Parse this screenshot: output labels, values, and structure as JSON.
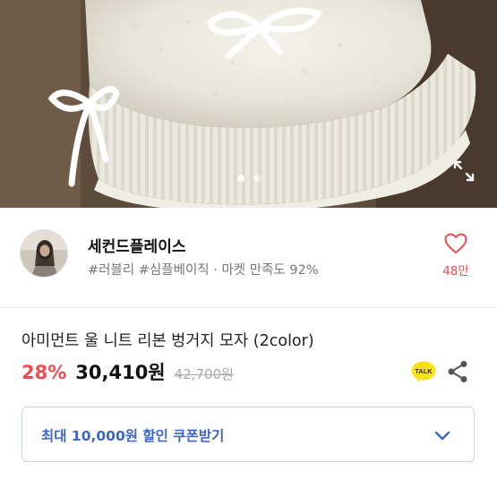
{
  "image_carousel": {
    "page_count": 2,
    "active_index": 0
  },
  "seller": {
    "name": "세컨드플레이스",
    "tags": "#러블리 #심플베이직 · 마켓 만족도 92%",
    "like_count": "48만"
  },
  "product": {
    "title": "아미먼트 울 니트 리본 벙거지 모자 (2color)",
    "discount": "28%",
    "sale_price": "30,410원",
    "original_price": "42,700원"
  },
  "actions": {
    "talk_label": "TALK"
  },
  "coupon": {
    "label": "최대 10,000원 할인 쿠폰받기"
  },
  "colors": {
    "accent_red": "#f04b52",
    "coupon_blue": "#3d66c9",
    "talk_yellow": "#f7e316"
  }
}
